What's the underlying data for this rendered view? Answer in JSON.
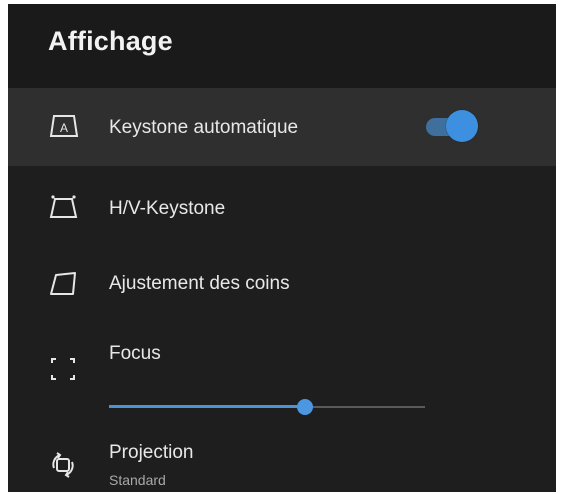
{
  "header": {
    "title": "Affichage"
  },
  "items": [
    {
      "label": "Keystone automatique",
      "icon": "auto-keystone-icon",
      "toggle": true
    },
    {
      "label": "H/V-Keystone",
      "icon": "keystone-trapezoid-icon"
    },
    {
      "label": "Ajustement des coins",
      "icon": "corner-adjust-icon"
    },
    {
      "label": "Focus",
      "icon": "focus-icon",
      "slider_value": 0.62
    },
    {
      "label": "Projection",
      "sublabel": "Standard",
      "icon": "projection-rotate-icon"
    }
  ],
  "icons": {
    "auto_keystone_letter": "A"
  },
  "colors": {
    "accent": "#4b97e2",
    "toggle_track": "#3f6f9c",
    "background": "#1e1e1e",
    "selected_row": "#2f2f2f"
  }
}
